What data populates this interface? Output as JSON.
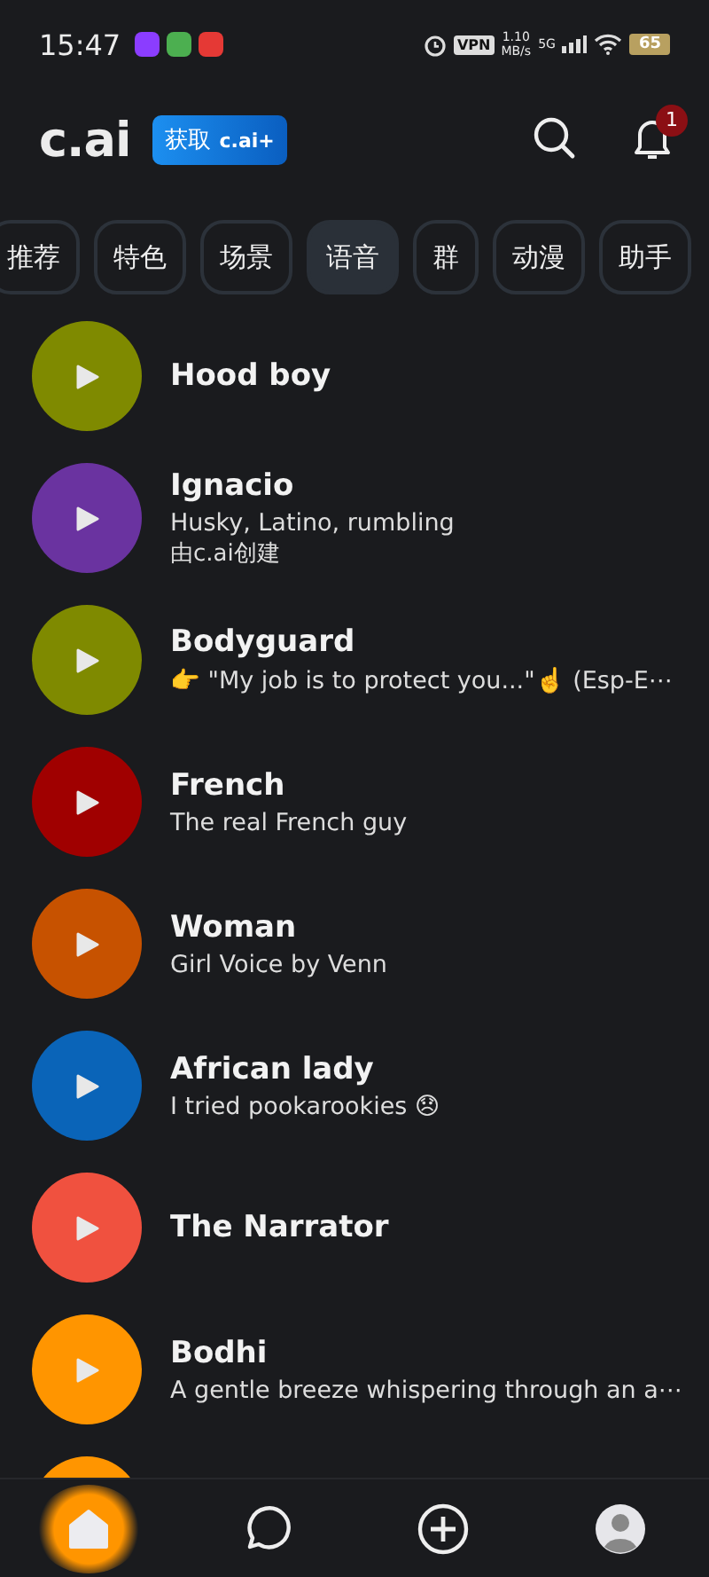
{
  "status_bar": {
    "time": "15:47",
    "app_icons": [
      {
        "color": "#8b3dff"
      },
      {
        "color": "#4caf50"
      },
      {
        "color": "#e53935"
      }
    ],
    "vpn": "VPN",
    "speed": "1.10",
    "speed_unit": "MB/s",
    "network": "5G",
    "battery": "65"
  },
  "header": {
    "logo": "c.ai",
    "upgrade_prefix": "获取",
    "upgrade_brand": "c.ai+",
    "notification_count": "1"
  },
  "categories": [
    {
      "label": "推荐",
      "selected": false
    },
    {
      "label": "特色",
      "selected": false
    },
    {
      "label": "场景",
      "selected": false
    },
    {
      "label": "语音",
      "selected": true
    },
    {
      "label": "群",
      "selected": false
    },
    {
      "label": "动漫",
      "selected": false
    },
    {
      "label": "助手",
      "selected": false
    }
  ],
  "voices": [
    {
      "name": "Hood boy",
      "color": "#7f8a00"
    },
    {
      "name": "Ignacio",
      "subtitle": "Husky, Latino, rumbling",
      "creator": "由c.ai创建",
      "color": "#6a33a0"
    },
    {
      "name": "Bodyguard",
      "subtitle": "👉 \"My job is to protect you...\"☝️ (Esp-E⋯",
      "color": "#7f8a00"
    },
    {
      "name": "French",
      "subtitle": "The real French guy",
      "color": "#a00000"
    },
    {
      "name": "Woman",
      "subtitle": "Girl Voice by Venn",
      "color": "#c75200"
    },
    {
      "name": "African lady",
      "subtitle": "I tried pookarookies 😞",
      "color": "#0a64b8"
    },
    {
      "name": "The Narrator",
      "color": "#f0513f"
    },
    {
      "name": "Bodhi",
      "subtitle": "A gentle breeze whispering through an a⋯",
      "color": "#ff9500"
    },
    {
      "color": "#ff9500"
    }
  ],
  "nav": [
    {
      "kind": "home",
      "selected": true
    },
    {
      "kind": "chat",
      "selected": false
    },
    {
      "kind": "create",
      "selected": false
    },
    {
      "kind": "profile",
      "selected": false
    }
  ]
}
